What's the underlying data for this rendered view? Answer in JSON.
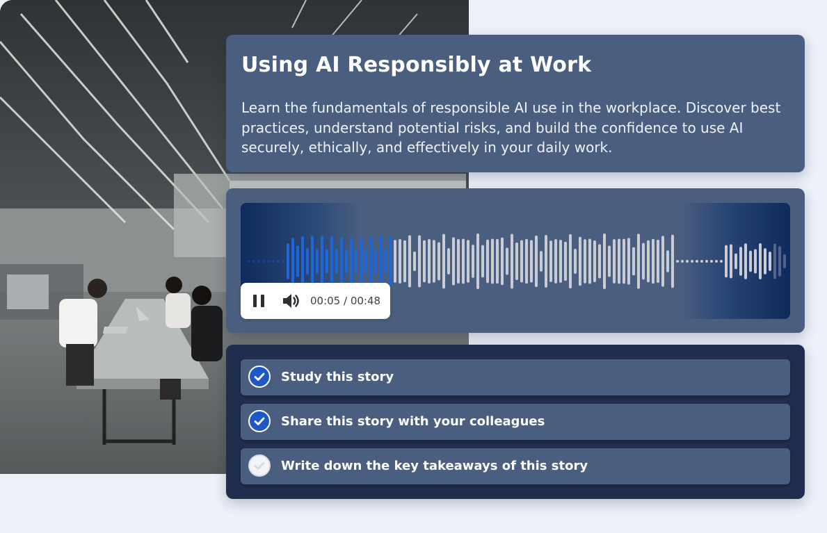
{
  "course": {
    "title": "Using AI Responsibly at Work",
    "description": "Learn the fundamentals of responsible AI use in the workplace. Discover best practices, understand potential risks, and build the confidence to use AI securely, ethically, and effectively in your daily work."
  },
  "audio_player": {
    "current_time": "00:05",
    "duration": "00:48",
    "time_display": "00:05 / 00:48",
    "progress": 0.104,
    "state": "playing",
    "controls": [
      "pause-icon",
      "volume-icon"
    ]
  },
  "tasks": [
    {
      "label": "Study this story",
      "completed": true
    },
    {
      "label": "Share this story with your colleagues",
      "completed": true
    },
    {
      "label": "Write down the key takeaways of this story",
      "completed": false
    }
  ],
  "colors": {
    "card_background": "#4a5f80",
    "task_panel_background": "#1e2e4c",
    "played_wave": "#1f66d6",
    "unplayed_wave": "#c9ccd4",
    "check_done": "#1f57c8",
    "page_background": "#edf1f8"
  }
}
